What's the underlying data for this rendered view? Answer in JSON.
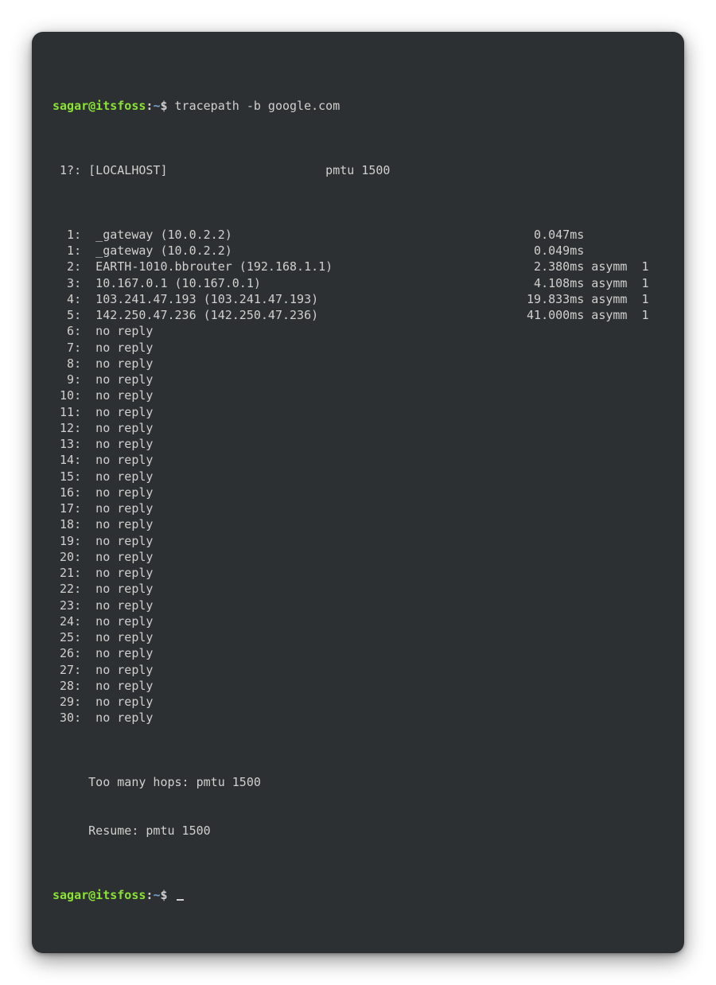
{
  "prompt": {
    "user_host": "sagar@itsfoss",
    "colon": ":",
    "path": "~",
    "dollar": "$"
  },
  "command": "tracepath -b google.com",
  "header_line": " 1?: [LOCALHOST]                      pmtu 1500",
  "hops": [
    {
      "n": "1",
      "host": "_gateway (10.0.2.2)",
      "rtt": "0.047ms",
      "asymm": ""
    },
    {
      "n": "1",
      "host": "_gateway (10.0.2.2)",
      "rtt": "0.049ms",
      "asymm": ""
    },
    {
      "n": "2",
      "host": "EARTH-1010.bbrouter (192.168.1.1)",
      "rtt": "2.380ms",
      "asymm": "asymm  1"
    },
    {
      "n": "3",
      "host": "10.167.0.1 (10.167.0.1)",
      "rtt": "4.108ms",
      "asymm": "asymm  1"
    },
    {
      "n": "4",
      "host": "103.241.47.193 (103.241.47.193)",
      "rtt": "19.833ms",
      "asymm": "asymm  1"
    },
    {
      "n": "5",
      "host": "142.250.47.236 (142.250.47.236)",
      "rtt": "41.000ms",
      "asymm": "asymm  1"
    },
    {
      "n": "6",
      "host": "no reply",
      "rtt": "",
      "asymm": ""
    },
    {
      "n": "7",
      "host": "no reply",
      "rtt": "",
      "asymm": ""
    },
    {
      "n": "8",
      "host": "no reply",
      "rtt": "",
      "asymm": ""
    },
    {
      "n": "9",
      "host": "no reply",
      "rtt": "",
      "asymm": ""
    },
    {
      "n": "10",
      "host": "no reply",
      "rtt": "",
      "asymm": ""
    },
    {
      "n": "11",
      "host": "no reply",
      "rtt": "",
      "asymm": ""
    },
    {
      "n": "12",
      "host": "no reply",
      "rtt": "",
      "asymm": ""
    },
    {
      "n": "13",
      "host": "no reply",
      "rtt": "",
      "asymm": ""
    },
    {
      "n": "14",
      "host": "no reply",
      "rtt": "",
      "asymm": ""
    },
    {
      "n": "15",
      "host": "no reply",
      "rtt": "",
      "asymm": ""
    },
    {
      "n": "16",
      "host": "no reply",
      "rtt": "",
      "asymm": ""
    },
    {
      "n": "17",
      "host": "no reply",
      "rtt": "",
      "asymm": ""
    },
    {
      "n": "18",
      "host": "no reply",
      "rtt": "",
      "asymm": ""
    },
    {
      "n": "19",
      "host": "no reply",
      "rtt": "",
      "asymm": ""
    },
    {
      "n": "20",
      "host": "no reply",
      "rtt": "",
      "asymm": ""
    },
    {
      "n": "21",
      "host": "no reply",
      "rtt": "",
      "asymm": ""
    },
    {
      "n": "22",
      "host": "no reply",
      "rtt": "",
      "asymm": ""
    },
    {
      "n": "23",
      "host": "no reply",
      "rtt": "",
      "asymm": ""
    },
    {
      "n": "24",
      "host": "no reply",
      "rtt": "",
      "asymm": ""
    },
    {
      "n": "25",
      "host": "no reply",
      "rtt": "",
      "asymm": ""
    },
    {
      "n": "26",
      "host": "no reply",
      "rtt": "",
      "asymm": ""
    },
    {
      "n": "27",
      "host": "no reply",
      "rtt": "",
      "asymm": ""
    },
    {
      "n": "28",
      "host": "no reply",
      "rtt": "",
      "asymm": ""
    },
    {
      "n": "29",
      "host": "no reply",
      "rtt": "",
      "asymm": ""
    },
    {
      "n": "30",
      "host": "no reply",
      "rtt": "",
      "asymm": ""
    }
  ],
  "footer": {
    "too_many": "     Too many hops: pmtu 1500",
    "resume": "     Resume: pmtu 1500"
  },
  "columns": {
    "host_width": 58,
    "rtt_width": 10
  }
}
